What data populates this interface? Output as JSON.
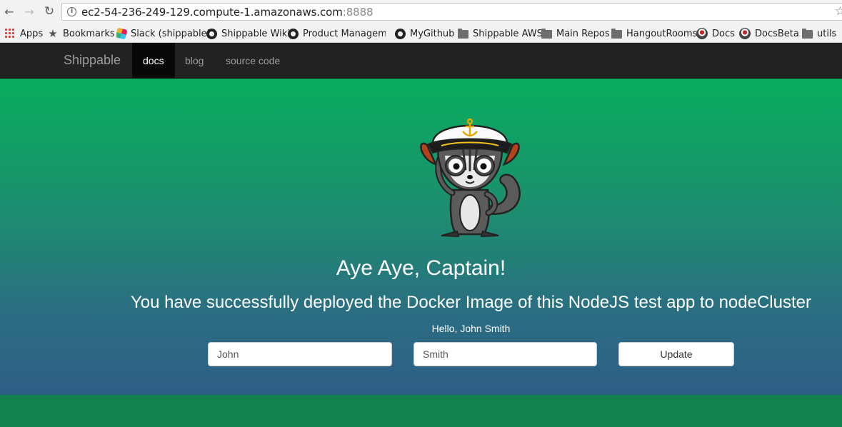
{
  "browser": {
    "url_host": "ec2-54-236-249-129.compute-1.amazonaws.com",
    "url_port": ":8888",
    "bookmarks": [
      {
        "label": "Apps",
        "icon": "apps-grid-icon"
      },
      {
        "label": "Bookmarks",
        "icon": "star-icon"
      },
      {
        "label": "Slack (shippable)",
        "icon": "slack-icon"
      },
      {
        "label": "Shippable Wiki",
        "icon": "github-icon"
      },
      {
        "label": "Product Manageme",
        "icon": "github-icon"
      },
      {
        "label": "MyGithub",
        "icon": "github-icon"
      },
      {
        "label": "Shippable AWS",
        "icon": "folder-icon"
      },
      {
        "label": "Main Repos",
        "icon": "folder-icon"
      },
      {
        "label": "HangoutRooms",
        "icon": "folder-icon"
      },
      {
        "label": "Docs",
        "icon": "shippable-icon"
      },
      {
        "label": "DocsBeta",
        "icon": "shippable-icon"
      },
      {
        "label": "utils",
        "icon": "folder-icon"
      }
    ]
  },
  "navbar": {
    "brand": "Shippable",
    "links": [
      {
        "label": "docs",
        "active": true
      },
      {
        "label": "blog",
        "active": false
      },
      {
        "label": "source code",
        "active": false
      }
    ]
  },
  "hero": {
    "mascot": "captain-lemur-mascot",
    "headline": "Aye Aye, Captain!",
    "subline": "You have successfully deployed the Docker Image of this NodeJS test app to nodeCluster",
    "greeting": "Hello, John Smith",
    "first_name_value": "John",
    "last_name_value": "Smith",
    "update_label": "Update"
  },
  "colors": {
    "navbar_bg": "#222222",
    "hero_top": "#08ae5d",
    "hero_bottom": "#2e5f87",
    "footer": "#12834f"
  }
}
